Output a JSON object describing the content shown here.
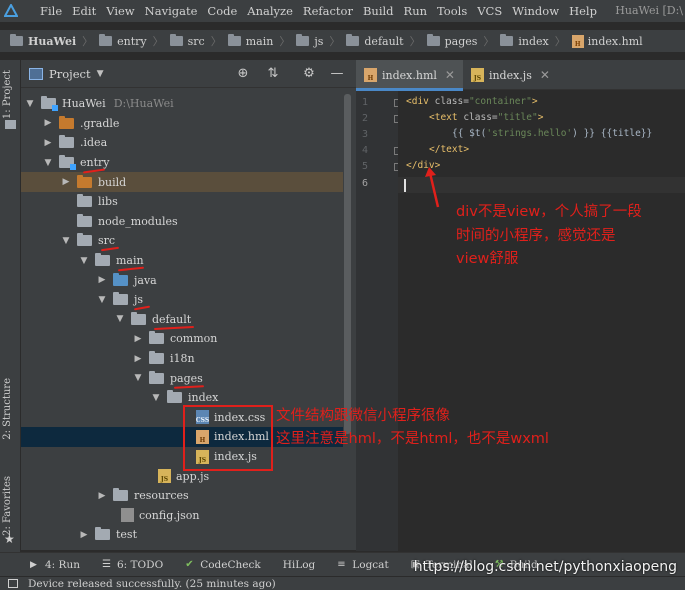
{
  "menubar": {
    "items": [
      "File",
      "Edit",
      "View",
      "Navigate",
      "Code",
      "Analyze",
      "Refactor",
      "Build",
      "Run",
      "Tools",
      "VCS",
      "Window",
      "Help"
    ],
    "window_title": "HuaWei [D:\\"
  },
  "breadcrumb": [
    "HuaWei",
    "entry",
    "src",
    "main",
    "js",
    "default",
    "pages",
    "index",
    "index.hml"
  ],
  "left_strip": {
    "project_tab": "1: Project",
    "structure_tab": "2: Structure",
    "favorites_tab": "2: Favorites"
  },
  "project_panel": {
    "title": "Project",
    "tree": [
      {
        "label": "HuaWei",
        "path": "D:\\HuaWei",
        "arrow": "down"
      },
      {
        "label": ".gradle",
        "arrow": "right"
      },
      {
        "label": ".idea",
        "arrow": "right"
      },
      {
        "label": "entry",
        "arrow": "down"
      },
      {
        "label": "build",
        "arrow": "right"
      },
      {
        "label": "libs",
        "arrow": ""
      },
      {
        "label": "node_modules",
        "arrow": ""
      },
      {
        "label": "src",
        "arrow": "down"
      },
      {
        "label": "main",
        "arrow": "down"
      },
      {
        "label": "java",
        "arrow": "right"
      },
      {
        "label": "js",
        "arrow": "down"
      },
      {
        "label": "default",
        "arrow": "down"
      },
      {
        "label": "common",
        "arrow": "right"
      },
      {
        "label": "i18n",
        "arrow": "right"
      },
      {
        "label": "pages",
        "arrow": "down"
      },
      {
        "label": "index",
        "arrow": "down"
      },
      {
        "label": "index.css",
        "arrow": ""
      },
      {
        "label": "index.hml",
        "arrow": ""
      },
      {
        "label": "index.js",
        "arrow": ""
      },
      {
        "label": "app.js",
        "arrow": ""
      },
      {
        "label": "resources",
        "arrow": "right"
      },
      {
        "label": "config.json",
        "arrow": ""
      },
      {
        "label": "test",
        "arrow": "right"
      }
    ]
  },
  "editor": {
    "tabs": [
      {
        "label": "index.hml",
        "active": true
      },
      {
        "label": "index.js",
        "active": false
      }
    ],
    "line_numbers": [
      "1",
      "2",
      "3",
      "4",
      "5",
      "6"
    ],
    "code": {
      "l1_open": "<div ",
      "l1_attr": "class=",
      "l1_val": "\"container\"",
      "l1_close": ">",
      "l2_open": "<text ",
      "l2_attr": "class=",
      "l2_val": "\"title\"",
      "l2_close": ">",
      "l3_a": "{{ ",
      "l3_fn": "$t(",
      "l3_str": "'strings.hello'",
      "l3_b": ") }} {{",
      "l3_var": "title",
      "l3_c": "}}",
      "l4": "</text>",
      "l5": "</div>"
    }
  },
  "annotations": {
    "div_note_1": "div不是view，个人搞了一段",
    "div_note_2": "时间的小程序，感觉还是",
    "div_note_3": "view舒服",
    "file_note_1": "文件结构跟微信小程序很像",
    "file_note_2": "这里注意是hml，不是html，也不是wxml"
  },
  "bottom_tools": [
    "4: Run",
    "6: TODO",
    "CodeCheck",
    "HiLog",
    "Logcat",
    "Terminal",
    "Build"
  ],
  "watermark": "https://blog.csdn.net/pythonxiaopeng",
  "status": "Device released successfully. (25 minutes ago)",
  "colors": {
    "annotation_red": "#e0201b",
    "tab_accent": "#4a88c7"
  }
}
